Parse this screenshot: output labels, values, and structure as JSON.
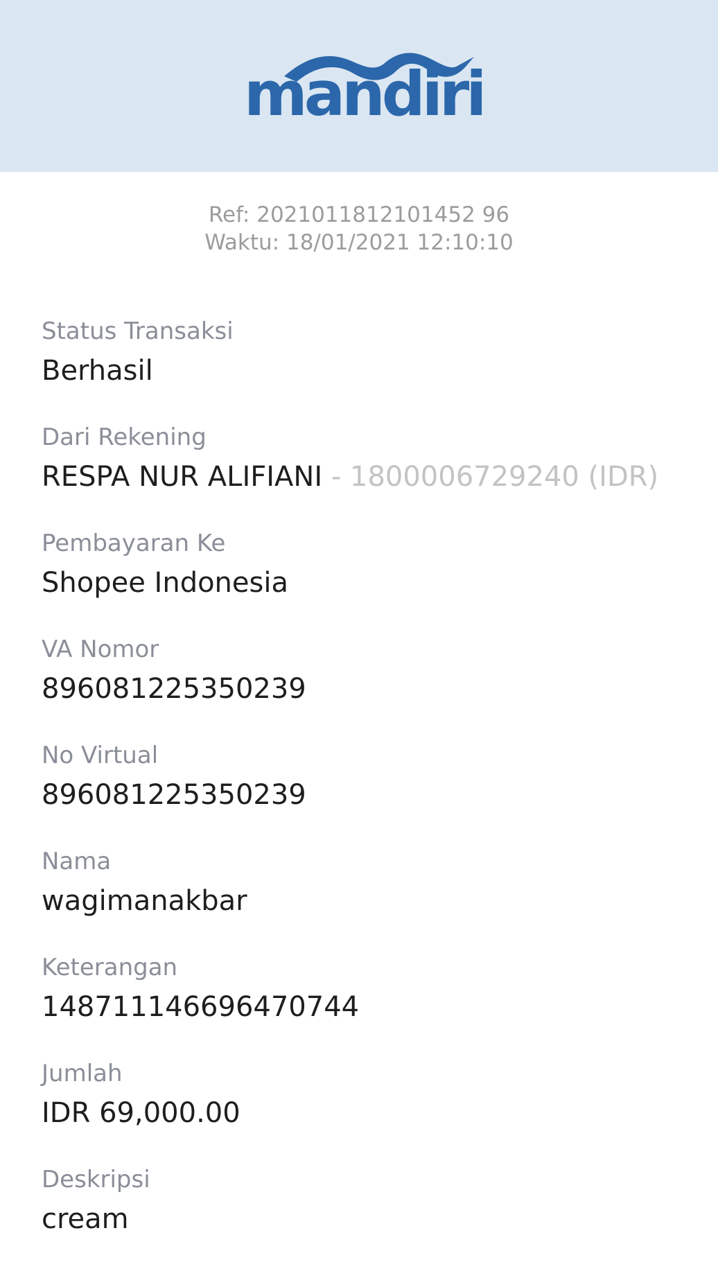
{
  "header": {
    "logo_text": "mandiri",
    "background_color": "#dae6f2",
    "brand_color": "#2b67aa"
  },
  "receipt": {
    "ref": "Ref: 2021011812101452 96",
    "time": "Waktu: 18/01/2021 12:10:10"
  },
  "fields": {
    "status": {
      "label": "Status Transaksi",
      "value": "Berhasil"
    },
    "from_account": {
      "label": "Dari Rekening",
      "value": "RESPA NUR ALIFIANI",
      "sub": " - 1800006729240 (IDR)"
    },
    "payment_to": {
      "label": "Pembayaran Ke",
      "value": "Shopee Indonesia"
    },
    "va_number": {
      "label": "VA Nomor",
      "value": "896081225350239"
    },
    "virtual_no": {
      "label": "No Virtual",
      "value": "896081225350239"
    },
    "name": {
      "label": "Nama",
      "value": "wagimanakbar"
    },
    "note": {
      "label": "Keterangan",
      "value": "148711146696470744"
    },
    "amount": {
      "label": "Jumlah",
      "value": "IDR 69,000.00"
    },
    "description": {
      "label": "Deskripsi",
      "value": "cream"
    }
  }
}
